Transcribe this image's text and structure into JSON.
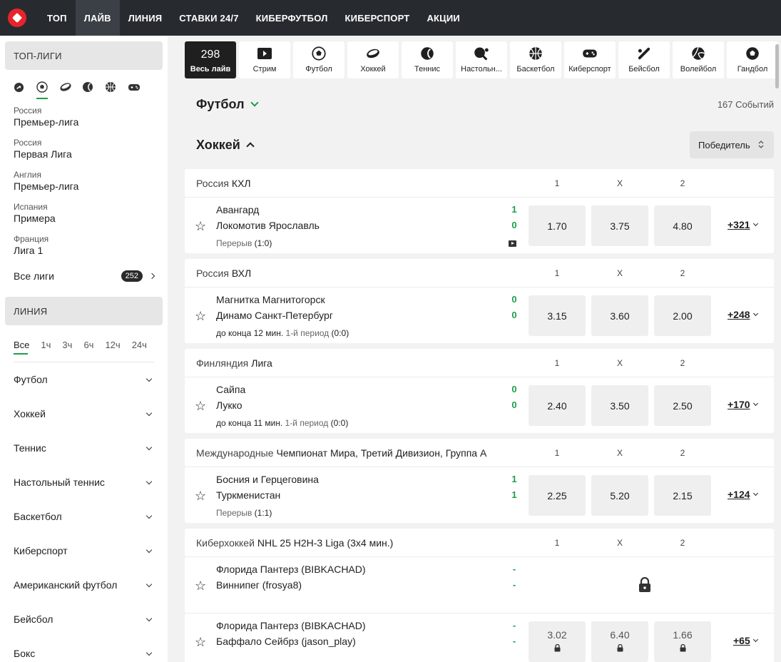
{
  "nav": {
    "items": [
      {
        "label": "ТОП",
        "active": false
      },
      {
        "label": "ЛАЙВ",
        "active": true
      },
      {
        "label": "ЛИНИЯ",
        "active": false
      },
      {
        "label": "СТАВКИ 24/7",
        "active": false
      },
      {
        "label": "КИБЕРФУТБОЛ",
        "active": false
      },
      {
        "label": "КИБЕРСПОРТ",
        "active": false
      },
      {
        "label": "АКЦИИ",
        "active": false
      }
    ]
  },
  "sidebar": {
    "top_title": "ТОП-ЛИГИ",
    "top_icons": [
      "clock-icon",
      "football-icon",
      "hockey-icon",
      "tennis-icon",
      "basketball-icon",
      "gamepad-icon"
    ],
    "leagues": [
      {
        "country": "Россия",
        "name": "Премьер-лига"
      },
      {
        "country": "Россия",
        "name": "Первая Лига"
      },
      {
        "country": "Англия",
        "name": "Премьер-лига"
      },
      {
        "country": "Испания",
        "name": "Примера"
      },
      {
        "country": "Франция",
        "name": "Лига 1"
      }
    ],
    "all_leagues": {
      "label": "Все лиги",
      "count": "252"
    },
    "line_title": "ЛИНИЯ",
    "periods": [
      "Все",
      "1ч",
      "3ч",
      "6ч",
      "12ч",
      "24ч"
    ],
    "sports": [
      "Футбол",
      "Хоккей",
      "Теннис",
      "Настольный теннис",
      "Баскетбол",
      "Киберспорт",
      "Американский футбол",
      "Бейсбол",
      "Бокс"
    ]
  },
  "sports_bar": {
    "live": {
      "count": "298",
      "label": "Весь лайв"
    },
    "items": [
      {
        "label": "Стрим",
        "icon": "play-icon"
      },
      {
        "label": "Футбол",
        "icon": "football-icon"
      },
      {
        "label": "Хоккей",
        "icon": "hockey-icon"
      },
      {
        "label": "Теннис",
        "icon": "tennis-icon"
      },
      {
        "label": "Настольн...",
        "icon": "table-tennis-icon"
      },
      {
        "label": "Баскетбол",
        "icon": "basketball-icon"
      },
      {
        "label": "Киберспорт",
        "icon": "gamepad-icon"
      },
      {
        "label": "Бейсбол",
        "icon": "baseball-icon"
      },
      {
        "label": "Волейбол",
        "icon": "volleyball-icon"
      },
      {
        "label": "Гандбол",
        "icon": "handball-icon"
      }
    ]
  },
  "football_section": {
    "title": "Футбол",
    "events_count": "167 Событий"
  },
  "hockey_section": {
    "title": "Хоккей",
    "selector": "Победитель"
  },
  "columns": [
    "1",
    "X",
    "2"
  ],
  "leagues": [
    {
      "country": "Россия",
      "name": "КХЛ",
      "events": [
        {
          "team1": "Авангард",
          "team2": "Локомотив Ярославль",
          "score1": "1",
          "score2": "0",
          "time": "",
          "period": "Перерыв",
          "score_detail": "(1:0)",
          "stream": true,
          "odds": [
            "1.70",
            "3.75",
            "4.80"
          ],
          "locked": false,
          "more": "+321"
        }
      ]
    },
    {
      "country": "Россия",
      "name": "ВХЛ",
      "events": [
        {
          "team1": "Магнитка Магнитогорск",
          "team2": "Динамо Санкт-Петербург",
          "score1": "0",
          "score2": "0",
          "time": "до конца 12 мин.",
          "period": "1-й период",
          "score_detail": "(0:0)",
          "stream": false,
          "odds": [
            "3.15",
            "3.60",
            "2.00"
          ],
          "locked": false,
          "more": "+248"
        }
      ]
    },
    {
      "country": "Финляндия",
      "name": "Лига",
      "events": [
        {
          "team1": "Сайпа",
          "team2": "Лукко",
          "score1": "0",
          "score2": "0",
          "time": "до конца 11 мин.",
          "period": "1-й период",
          "score_detail": "(0:0)",
          "stream": false,
          "odds": [
            "2.40",
            "3.50",
            "2.50"
          ],
          "locked": false,
          "more": "+170"
        }
      ]
    },
    {
      "country": "Международные",
      "name": "Чемпионат Мира, Третий Дивизион, Группа А",
      "events": [
        {
          "team1": "Босния и Герцеговина",
          "team2": "Туркменистан",
          "score1": "1",
          "score2": "1",
          "time": "",
          "period": "Перерыв",
          "score_detail": "(1:1)",
          "stream": false,
          "odds": [
            "2.25",
            "5.20",
            "2.15"
          ],
          "locked": false,
          "more": "+124"
        }
      ]
    },
    {
      "country": "Киберхоккей",
      "name": "NHL 25 H2H-3 Liga (3x4 мин.)",
      "events": [
        {
          "team1": "Флорида Пантерз (BIBKACHAD)",
          "team2": "Виннипег (frosya8)",
          "score1": "-",
          "score2": "-",
          "time": "",
          "period": "",
          "score_detail": "",
          "stream": false,
          "odds": [],
          "locked": true,
          "more": ""
        },
        {
          "team1": "Флорида Пантерз (BIBKACHAD)",
          "team2": "Баффало Сейбрз (jason_play)",
          "score1": "-",
          "score2": "-",
          "time": "",
          "period": "",
          "score_detail": "",
          "stream": false,
          "odds": [
            "3.02",
            "6.40",
            "1.66"
          ],
          "locked": "odds",
          "more": "+65"
        }
      ]
    }
  ],
  "colors": {
    "accent": "#1b9e4b",
    "nav_bg": "#272b30",
    "live_bg": "#1f1f1f"
  }
}
